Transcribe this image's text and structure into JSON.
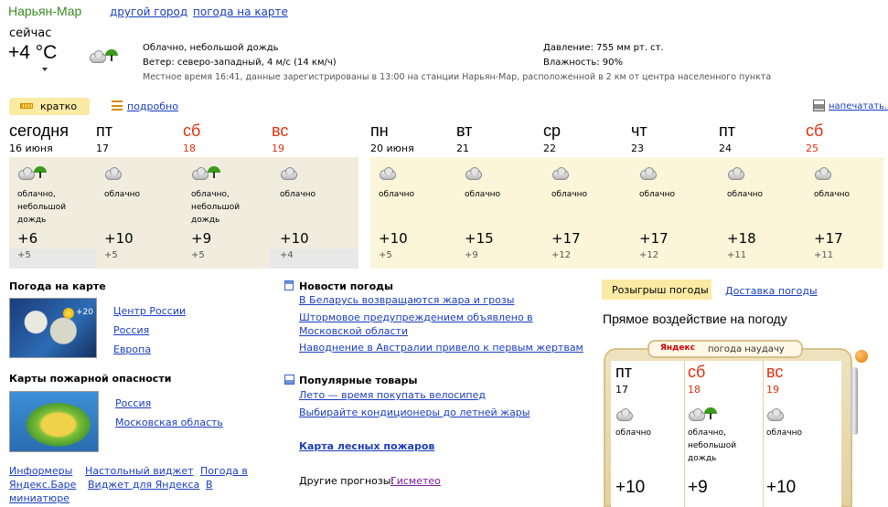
{
  "header": {
    "city": "Нарьян-Мар",
    "other_city": "другой город",
    "map_weather": "погода на карте"
  },
  "current": {
    "now_label": "сейчас",
    "temp": "+4 °C",
    "condition": "Облачно, небольшой дождь",
    "wind": "Ветер: северо-западный, 4 м/с (14 км/ч)",
    "pressure": "Давление: 755 мм рт. ст.",
    "humidity": "Влажность: 90%",
    "station_note": "Местное время 16:41, данные зарегистрированы в 13:00 на станции Нарьян-Мар, расположенной в 2 км от центра населенного пункта"
  },
  "views": {
    "brief": "кратко",
    "detailed": "подробно",
    "print": "напечатать..."
  },
  "days": [
    {
      "name": "сегодня",
      "date": "16 июня",
      "weekend": false,
      "desc": "облачно,\nнебольшой дождь",
      "rain": true,
      "t_day": "+6",
      "t_night": "+5"
    },
    {
      "name": "пт",
      "date": "17",
      "weekend": false,
      "desc": "облачно",
      "rain": false,
      "t_day": "+10",
      "t_night": "+5"
    },
    {
      "name": "сб",
      "date": "18",
      "weekend": true,
      "desc": "облачно,\nнебольшой\nдождь",
      "rain": true,
      "t_day": "+9",
      "t_night": "+5"
    },
    {
      "name": "вс",
      "date": "19",
      "weekend": true,
      "desc": "облачно",
      "rain": false,
      "t_day": "+10",
      "t_night": "+4"
    },
    {
      "name": "пн",
      "date": "20 июня",
      "weekend": false,
      "desc": "облачно",
      "rain": false,
      "t_day": "+10",
      "t_night": "+5"
    },
    {
      "name": "вт",
      "date": "21",
      "weekend": false,
      "desc": "облачно",
      "rain": false,
      "t_day": "+15",
      "t_night": "+9"
    },
    {
      "name": "ср",
      "date": "22",
      "weekend": false,
      "desc": "облачно",
      "rain": false,
      "t_day": "+17",
      "t_night": "+12"
    },
    {
      "name": "чт",
      "date": "23",
      "weekend": false,
      "desc": "облачно",
      "rain": false,
      "t_day": "+17",
      "t_night": "+12"
    },
    {
      "name": "пт",
      "date": "24",
      "weekend": false,
      "desc": "облачно",
      "rain": false,
      "t_day": "+18",
      "t_night": "+11"
    },
    {
      "name": "сб",
      "date": "25",
      "weekend": true,
      "desc": "облачно",
      "rain": false,
      "t_day": "+17",
      "t_night": "+11"
    }
  ],
  "map_block": {
    "title": "Погода на карте",
    "badge": "+20",
    "links": [
      "Центр России",
      "Россия",
      "Европа"
    ]
  },
  "fire_block": {
    "title": "Карты пожарной опасности",
    "links": [
      "Россия",
      "Московская область"
    ]
  },
  "footer_links": {
    "informers": "Информеры",
    "desktop_widget": "Настольный виджет",
    "weather_in": "Погода в",
    "yandex_bar": "Яндекс.Баре",
    "yandex_widget": "Виджет для Яндекса",
    "in": "В",
    "miniature": "миниатюре"
  },
  "news": {
    "title": "Новости погоды",
    "items": [
      "В Беларусь возвращаются жара и грозы",
      "Штормовое предупреждением объявлено в Московской области",
      "Наводнение в Австралии привело к первым жертвам"
    ]
  },
  "goods": {
    "title": "Популярные товары",
    "items": [
      "Лето — время покупать велосипед",
      "Выбирайте кондиционеры до летней жары"
    ]
  },
  "fires_map_link": "Карта лесных пожаров",
  "other_forecasts": {
    "label": "Другие прогнозы:",
    "link": "Гисметео"
  },
  "promo": {
    "tab_active": "Розыгрыш погоды",
    "tab_other": "Доставка погоды",
    "headline": "Прямое воздействие на погоду",
    "machine_logo": "Яндекс",
    "machine_title": "погода наудачу",
    "days": [
      {
        "name": "пт",
        "date": "17",
        "weekend": false,
        "desc": "облачно",
        "rain": false,
        "temp": "+10"
      },
      {
        "name": "сб",
        "date": "18",
        "weekend": true,
        "desc": "облачно,\nнебольшой\nдождь",
        "rain": true,
        "temp": "+9"
      },
      {
        "name": "вс",
        "date": "19",
        "weekend": true,
        "desc": "облачно",
        "rain": false,
        "temp": "+10"
      }
    ]
  },
  "colors": {
    "accent_link": "#1a3dc1",
    "weekend_red": "#e0300e",
    "city_green": "#3b8a22",
    "cell_bg": "#f0eddf",
    "tab_bg": "#fbeaa4"
  }
}
